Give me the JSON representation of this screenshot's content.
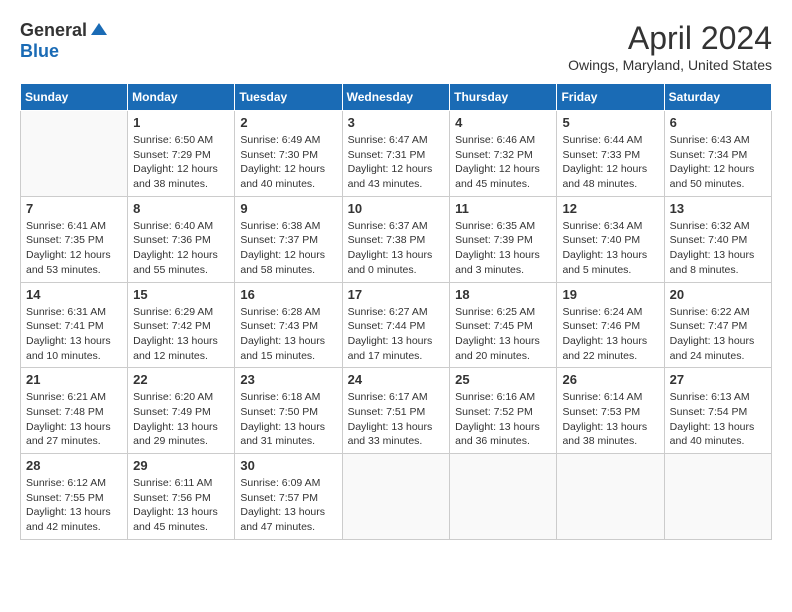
{
  "header": {
    "logo_general": "General",
    "logo_blue": "Blue",
    "title": "April 2024",
    "location": "Owings, Maryland, United States"
  },
  "days_of_week": [
    "Sunday",
    "Monday",
    "Tuesday",
    "Wednesday",
    "Thursday",
    "Friday",
    "Saturday"
  ],
  "weeks": [
    [
      {
        "day": "",
        "info": ""
      },
      {
        "day": "1",
        "info": "Sunrise: 6:50 AM\nSunset: 7:29 PM\nDaylight: 12 hours\nand 38 minutes."
      },
      {
        "day": "2",
        "info": "Sunrise: 6:49 AM\nSunset: 7:30 PM\nDaylight: 12 hours\nand 40 minutes."
      },
      {
        "day": "3",
        "info": "Sunrise: 6:47 AM\nSunset: 7:31 PM\nDaylight: 12 hours\nand 43 minutes."
      },
      {
        "day": "4",
        "info": "Sunrise: 6:46 AM\nSunset: 7:32 PM\nDaylight: 12 hours\nand 45 minutes."
      },
      {
        "day": "5",
        "info": "Sunrise: 6:44 AM\nSunset: 7:33 PM\nDaylight: 12 hours\nand 48 minutes."
      },
      {
        "day": "6",
        "info": "Sunrise: 6:43 AM\nSunset: 7:34 PM\nDaylight: 12 hours\nand 50 minutes."
      }
    ],
    [
      {
        "day": "7",
        "info": "Sunrise: 6:41 AM\nSunset: 7:35 PM\nDaylight: 12 hours\nand 53 minutes."
      },
      {
        "day": "8",
        "info": "Sunrise: 6:40 AM\nSunset: 7:36 PM\nDaylight: 12 hours\nand 55 minutes."
      },
      {
        "day": "9",
        "info": "Sunrise: 6:38 AM\nSunset: 7:37 PM\nDaylight: 12 hours\nand 58 minutes."
      },
      {
        "day": "10",
        "info": "Sunrise: 6:37 AM\nSunset: 7:38 PM\nDaylight: 13 hours\nand 0 minutes."
      },
      {
        "day": "11",
        "info": "Sunrise: 6:35 AM\nSunset: 7:39 PM\nDaylight: 13 hours\nand 3 minutes."
      },
      {
        "day": "12",
        "info": "Sunrise: 6:34 AM\nSunset: 7:40 PM\nDaylight: 13 hours\nand 5 minutes."
      },
      {
        "day": "13",
        "info": "Sunrise: 6:32 AM\nSunset: 7:40 PM\nDaylight: 13 hours\nand 8 minutes."
      }
    ],
    [
      {
        "day": "14",
        "info": "Sunrise: 6:31 AM\nSunset: 7:41 PM\nDaylight: 13 hours\nand 10 minutes."
      },
      {
        "day": "15",
        "info": "Sunrise: 6:29 AM\nSunset: 7:42 PM\nDaylight: 13 hours\nand 12 minutes."
      },
      {
        "day": "16",
        "info": "Sunrise: 6:28 AM\nSunset: 7:43 PM\nDaylight: 13 hours\nand 15 minutes."
      },
      {
        "day": "17",
        "info": "Sunrise: 6:27 AM\nSunset: 7:44 PM\nDaylight: 13 hours\nand 17 minutes."
      },
      {
        "day": "18",
        "info": "Sunrise: 6:25 AM\nSunset: 7:45 PM\nDaylight: 13 hours\nand 20 minutes."
      },
      {
        "day": "19",
        "info": "Sunrise: 6:24 AM\nSunset: 7:46 PM\nDaylight: 13 hours\nand 22 minutes."
      },
      {
        "day": "20",
        "info": "Sunrise: 6:22 AM\nSunset: 7:47 PM\nDaylight: 13 hours\nand 24 minutes."
      }
    ],
    [
      {
        "day": "21",
        "info": "Sunrise: 6:21 AM\nSunset: 7:48 PM\nDaylight: 13 hours\nand 27 minutes."
      },
      {
        "day": "22",
        "info": "Sunrise: 6:20 AM\nSunset: 7:49 PM\nDaylight: 13 hours\nand 29 minutes."
      },
      {
        "day": "23",
        "info": "Sunrise: 6:18 AM\nSunset: 7:50 PM\nDaylight: 13 hours\nand 31 minutes."
      },
      {
        "day": "24",
        "info": "Sunrise: 6:17 AM\nSunset: 7:51 PM\nDaylight: 13 hours\nand 33 minutes."
      },
      {
        "day": "25",
        "info": "Sunrise: 6:16 AM\nSunset: 7:52 PM\nDaylight: 13 hours\nand 36 minutes."
      },
      {
        "day": "26",
        "info": "Sunrise: 6:14 AM\nSunset: 7:53 PM\nDaylight: 13 hours\nand 38 minutes."
      },
      {
        "day": "27",
        "info": "Sunrise: 6:13 AM\nSunset: 7:54 PM\nDaylight: 13 hours\nand 40 minutes."
      }
    ],
    [
      {
        "day": "28",
        "info": "Sunrise: 6:12 AM\nSunset: 7:55 PM\nDaylight: 13 hours\nand 42 minutes."
      },
      {
        "day": "29",
        "info": "Sunrise: 6:11 AM\nSunset: 7:56 PM\nDaylight: 13 hours\nand 45 minutes."
      },
      {
        "day": "30",
        "info": "Sunrise: 6:09 AM\nSunset: 7:57 PM\nDaylight: 13 hours\nand 47 minutes."
      },
      {
        "day": "",
        "info": ""
      },
      {
        "day": "",
        "info": ""
      },
      {
        "day": "",
        "info": ""
      },
      {
        "day": "",
        "info": ""
      }
    ]
  ]
}
